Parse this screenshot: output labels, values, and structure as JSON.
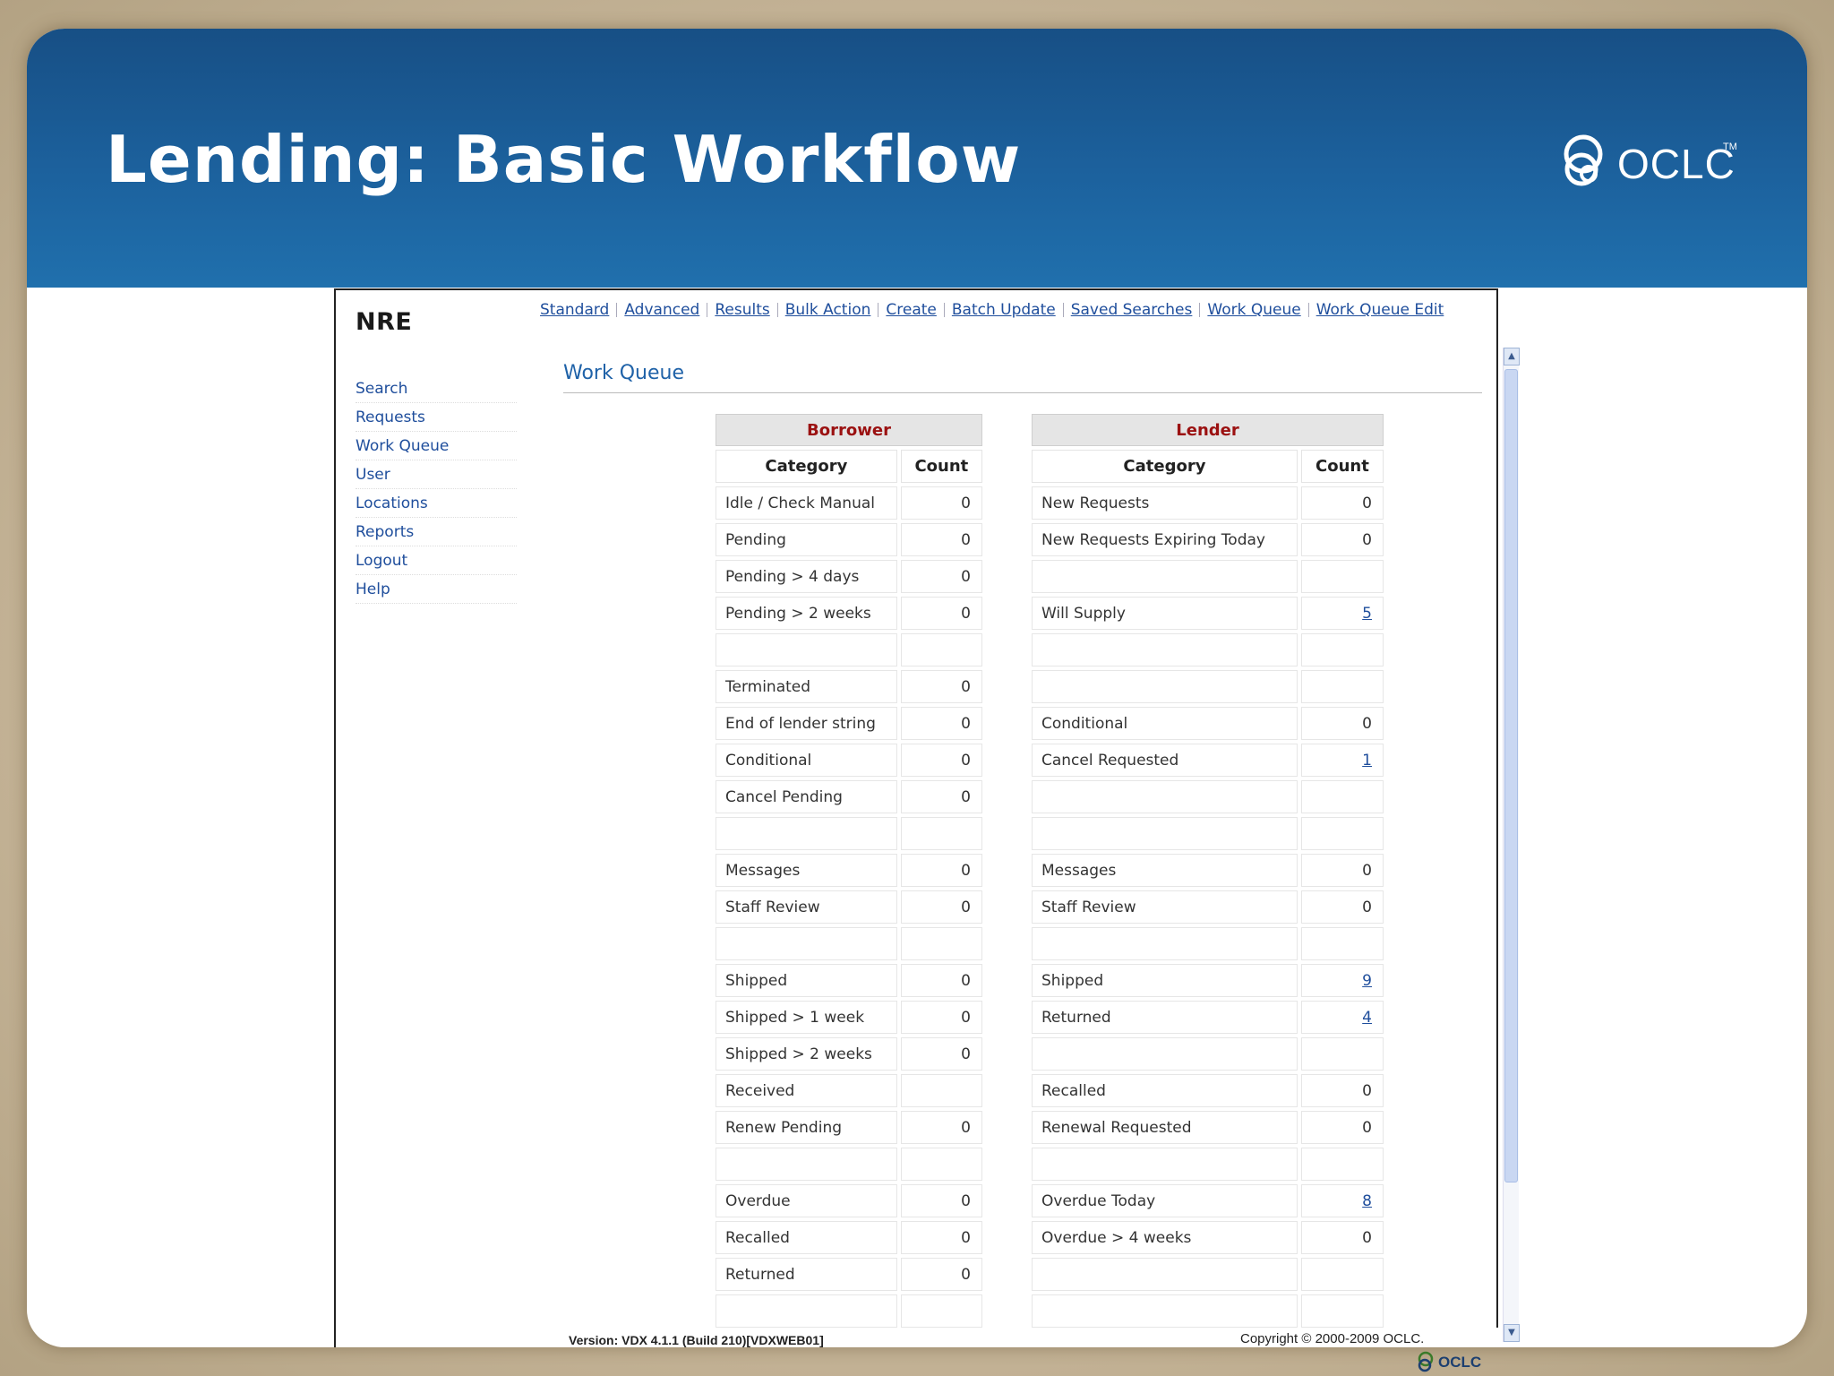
{
  "slide": {
    "title": "Lending: Basic Workflow",
    "logo_text": "OCLC",
    "logo_tm": "TM"
  },
  "app": {
    "site": "NRE",
    "top_nav": [
      "Standard",
      "Advanced",
      "Results",
      "Bulk Action",
      "Create",
      "Batch Update",
      "Saved Searches",
      "Work Queue",
      "Work Queue Edit"
    ],
    "side_nav": [
      "Search",
      "Requests",
      "Work Queue",
      "User",
      "Locations",
      "Reports",
      "Logout",
      "Help"
    ],
    "page_title": "Work Queue",
    "borrower": {
      "heading": "Borrower",
      "col_category": "Category",
      "col_count": "Count",
      "rows": [
        {
          "category": "Idle / Check Manual",
          "count": "0"
        },
        {
          "category": "Pending",
          "count": "0"
        },
        {
          "category": "Pending > 4 days",
          "count": "0"
        },
        {
          "category": "Pending > 2 weeks",
          "count": "0"
        },
        {
          "category": "",
          "count": ""
        },
        {
          "category": "Terminated",
          "count": "0"
        },
        {
          "category": "End of lender string",
          "count": "0"
        },
        {
          "category": "Conditional",
          "count": "0"
        },
        {
          "category": "Cancel Pending",
          "count": "0"
        },
        {
          "category": "",
          "count": ""
        },
        {
          "category": "Messages",
          "count": "0"
        },
        {
          "category": "Staff Review",
          "count": "0"
        },
        {
          "category": "",
          "count": ""
        },
        {
          "category": "Shipped",
          "count": "0"
        },
        {
          "category": "Shipped > 1 week",
          "count": "0"
        },
        {
          "category": "Shipped > 2 weeks",
          "count": "0"
        },
        {
          "category": "Received",
          "count": ""
        },
        {
          "category": "Renew Pending",
          "count": "0"
        },
        {
          "category": "",
          "count": ""
        },
        {
          "category": "Overdue",
          "count": "0"
        },
        {
          "category": "Recalled",
          "count": "0"
        },
        {
          "category": "Returned",
          "count": "0"
        },
        {
          "category": "",
          "count": ""
        }
      ]
    },
    "lender": {
      "heading": "Lender",
      "col_category": "Category",
      "col_count": "Count",
      "rows": [
        {
          "category": "New Requests",
          "count": "0"
        },
        {
          "category": "New Requests Expiring Today",
          "count": "0"
        },
        {
          "category": "",
          "count": ""
        },
        {
          "category": "Will Supply",
          "count": "5",
          "link": true
        },
        {
          "category": "",
          "count": ""
        },
        {
          "category": "",
          "count": ""
        },
        {
          "category": "Conditional",
          "count": "0"
        },
        {
          "category": "Cancel Requested",
          "count": "1",
          "link": true
        },
        {
          "category": "",
          "count": ""
        },
        {
          "category": "",
          "count": ""
        },
        {
          "category": "Messages",
          "count": "0"
        },
        {
          "category": "Staff Review",
          "count": "0"
        },
        {
          "category": "",
          "count": ""
        },
        {
          "category": "Shipped",
          "count": "9",
          "link": true
        },
        {
          "category": "Returned",
          "count": "4",
          "link": true
        },
        {
          "category": "",
          "count": ""
        },
        {
          "category": "Recalled",
          "count": "0"
        },
        {
          "category": "Renewal Requested",
          "count": "0"
        },
        {
          "category": "",
          "count": ""
        },
        {
          "category": "Overdue Today",
          "count": "8",
          "link": true
        },
        {
          "category": "Overdue > 4 weeks",
          "count": "0"
        },
        {
          "category": "",
          "count": ""
        },
        {
          "category": "",
          "count": ""
        }
      ]
    },
    "version": "Version: VDX 4.1.1 (Build 210)[VDXWEB01]",
    "copyright": "Copyright © 2000-2009 OCLC.",
    "footer_logo_text": "OCLC"
  },
  "colors": {
    "banner": "#1c619d",
    "group_heading": "#9b1111",
    "link": "#1f4e9c"
  }
}
